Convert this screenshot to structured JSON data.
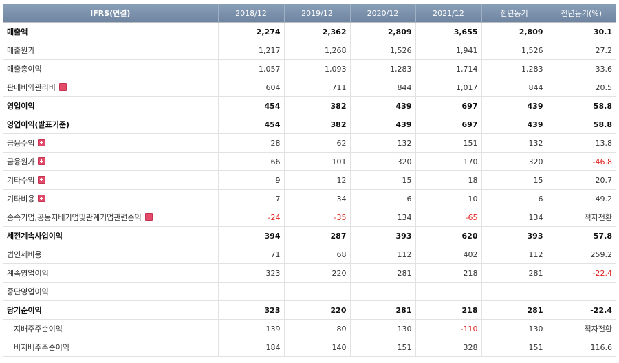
{
  "table": {
    "headers": [
      "IFRS(연결)",
      "2018/12",
      "2019/12",
      "2020/12",
      "2021/12",
      "전년동기",
      "전년동기(%)"
    ],
    "rows": [
      {
        "label": "매출액",
        "values": [
          "2,274",
          "2,362",
          "2,809",
          "3,655",
          "2,809",
          "30.1"
        ],
        "bold": true,
        "expand": false,
        "sub": false
      },
      {
        "label": "매출원가",
        "values": [
          "1,217",
          "1,268",
          "1,526",
          "1,941",
          "1,526",
          "27.2"
        ],
        "bold": false,
        "expand": false,
        "sub": false
      },
      {
        "label": "매출총이익",
        "values": [
          "1,057",
          "1,093",
          "1,283",
          "1,714",
          "1,283",
          "33.6"
        ],
        "bold": false,
        "expand": false,
        "sub": false
      },
      {
        "label": "판매비와관리비",
        "values": [
          "604",
          "711",
          "844",
          "1,017",
          "844",
          "20.5"
        ],
        "bold": false,
        "expand": true,
        "sub": false
      },
      {
        "label": "영업이익",
        "values": [
          "454",
          "382",
          "439",
          "697",
          "439",
          "58.8"
        ],
        "bold": true,
        "expand": false,
        "sub": false
      },
      {
        "label": "영업이익(발표기준)",
        "values": [
          "454",
          "382",
          "439",
          "697",
          "439",
          "58.8"
        ],
        "bold": true,
        "expand": false,
        "sub": false
      },
      {
        "label": "금융수익",
        "values": [
          "28",
          "62",
          "132",
          "151",
          "132",
          "13.8"
        ],
        "bold": false,
        "expand": true,
        "sub": false
      },
      {
        "label": "금융원가",
        "values": [
          "66",
          "101",
          "320",
          "170",
          "320",
          "-46.8"
        ],
        "bold": false,
        "expand": true,
        "sub": false
      },
      {
        "label": "기타수익",
        "values": [
          "9",
          "12",
          "15",
          "18",
          "15",
          "20.7"
        ],
        "bold": false,
        "expand": true,
        "sub": false
      },
      {
        "label": "기타비용",
        "values": [
          "7",
          "34",
          "6",
          "10",
          "6",
          "49.2"
        ],
        "bold": false,
        "expand": true,
        "sub": false
      },
      {
        "label": "종속기업,공동지배기업및관계기업관련손익",
        "values": [
          "-24",
          "-35",
          "134",
          "-65",
          "134",
          "적자전환"
        ],
        "bold": false,
        "expand": true,
        "sub": false
      },
      {
        "label": "세전계속사업이익",
        "values": [
          "394",
          "287",
          "393",
          "620",
          "393",
          "57.8"
        ],
        "bold": true,
        "expand": false,
        "sub": false
      },
      {
        "label": "법인세비용",
        "values": [
          "71",
          "68",
          "112",
          "402",
          "112",
          "259.2"
        ],
        "bold": false,
        "expand": false,
        "sub": false
      },
      {
        "label": "계속영업이익",
        "values": [
          "323",
          "220",
          "281",
          "218",
          "281",
          "-22.4"
        ],
        "bold": false,
        "expand": false,
        "sub": false
      },
      {
        "label": "중단영업이익",
        "values": [
          "",
          "",
          "",
          "",
          "",
          ""
        ],
        "bold": false,
        "expand": false,
        "sub": false
      },
      {
        "label": "당기순이익",
        "values": [
          "323",
          "220",
          "281",
          "218",
          "281",
          "-22.4"
        ],
        "bold": true,
        "expand": false,
        "sub": false
      },
      {
        "label": "지배주주순이익",
        "values": [
          "139",
          "80",
          "130",
          "-110",
          "130",
          "적자전환"
        ],
        "bold": false,
        "expand": false,
        "sub": true
      },
      {
        "label": "비지배주주순이익",
        "values": [
          "184",
          "140",
          "151",
          "328",
          "151",
          "116.6"
        ],
        "bold": false,
        "expand": false,
        "sub": true
      }
    ]
  },
  "colors": {
    "header_bg": "#7a90ab",
    "negative": "#e0241f",
    "expand_icon": "#e34b6a"
  },
  "icons": {
    "expand": "plus-icon"
  }
}
